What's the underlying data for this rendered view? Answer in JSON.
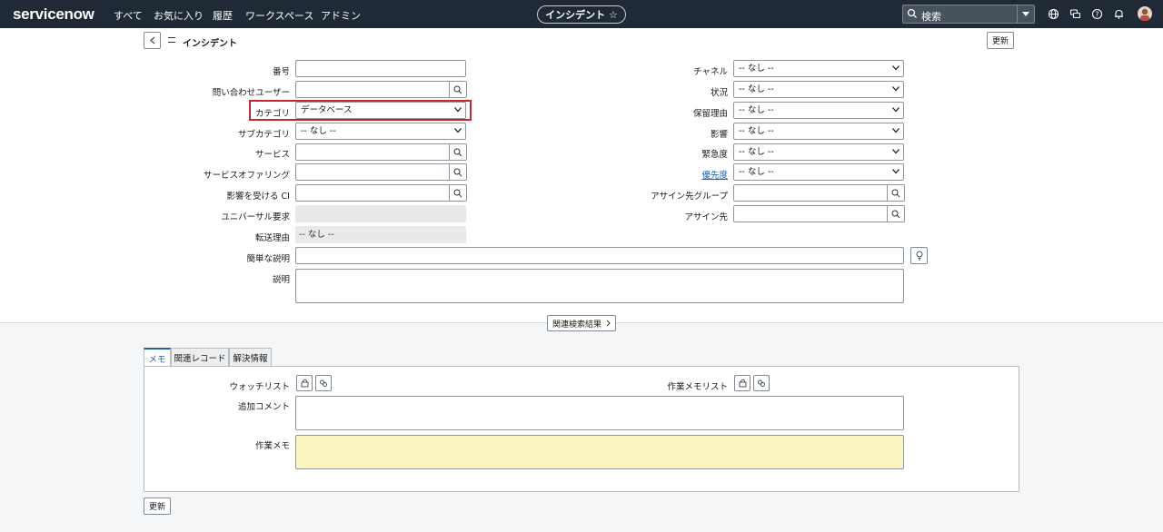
{
  "topbar": {
    "logo": "servicenow",
    "nav": [
      "すべて",
      "お気に入り",
      "履歴",
      "ワークスペース",
      "アドミン"
    ],
    "center_pill": "インシデント ☆",
    "search_placeholder": "検索"
  },
  "header": {
    "title": "インシデント",
    "update_button": "更新"
  },
  "form": {
    "left": [
      {
        "label": "番号",
        "value": ""
      },
      {
        "label": "問い合わせユーザー",
        "value": ""
      },
      {
        "label": "カテゴリ",
        "value": "データベース"
      },
      {
        "label": "サブカテゴリ",
        "value": "-- なし --"
      },
      {
        "label": "サービス",
        "value": ""
      },
      {
        "label": "サービスオファリング",
        "value": ""
      },
      {
        "label": "影響を受ける CI",
        "value": ""
      },
      {
        "label": "ユニバーサル要求",
        "value": ""
      },
      {
        "label": "転送理由",
        "value": "-- なし --"
      }
    ],
    "right": [
      {
        "label": "チャネル",
        "value": "-- なし --"
      },
      {
        "label": "状況",
        "value": "-- なし --"
      },
      {
        "label": "保留理由",
        "value": "-- なし --"
      },
      {
        "label": "影響",
        "value": "-- なし --"
      },
      {
        "label": "緊急度",
        "value": "-- なし --"
      },
      {
        "label": "優先度",
        "value": "-- なし --"
      },
      {
        "label": "アサイン先グループ",
        "value": ""
      },
      {
        "label": "アサイン先",
        "value": ""
      }
    ],
    "short_description_label": "簡単な説明",
    "description_label": "説明",
    "related_search_button": "関連検索結果"
  },
  "tabs": [
    "メモ",
    "関連レコード",
    "解決情報"
  ],
  "notes": {
    "watchlist_label": "ウォッチリスト",
    "work_notes_list_label": "作業メモリスト",
    "additional_comments_label": "追加コメント",
    "work_notes_label": "作業メモ"
  },
  "footer": {
    "update_button": "更新"
  },
  "colors": {
    "topbar": "#1f2a36",
    "highlight": "#c8262d",
    "work_notes_bg": "#fbf6c0",
    "link": "#1f5fb0"
  }
}
